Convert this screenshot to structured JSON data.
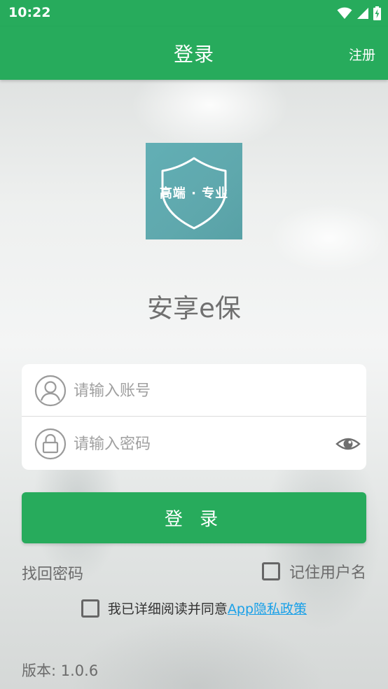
{
  "status_bar": {
    "time": "10:22",
    "icons": [
      "wifi-icon",
      "signal-icon",
      "battery-charging-icon"
    ]
  },
  "app_bar": {
    "title": "登录",
    "register_label": "注册"
  },
  "logo": {
    "text": "高端 · 专业",
    "icon": "shield-icon"
  },
  "app_name": "安享e保",
  "form": {
    "account": {
      "value": "",
      "placeholder": "请输入账号",
      "icon": "user-avatar-icon"
    },
    "password": {
      "value": "",
      "placeholder": "请输入密码",
      "icon": "lock-icon",
      "toggle_icon": "eye-icon"
    }
  },
  "login_button_label": "登 录",
  "forgot_password_label": "找回密码",
  "remember_username": {
    "label": "记住用户名",
    "checked": false
  },
  "agreement": {
    "prefix": "我已详细阅读并同意",
    "link_label": "App隐私政策",
    "checked": false
  },
  "version": "版本: 1.0.6",
  "colors": {
    "brand_green": "#27ab5c",
    "link_blue": "#19a0e8",
    "logo_teal": "#5fa8ad"
  }
}
